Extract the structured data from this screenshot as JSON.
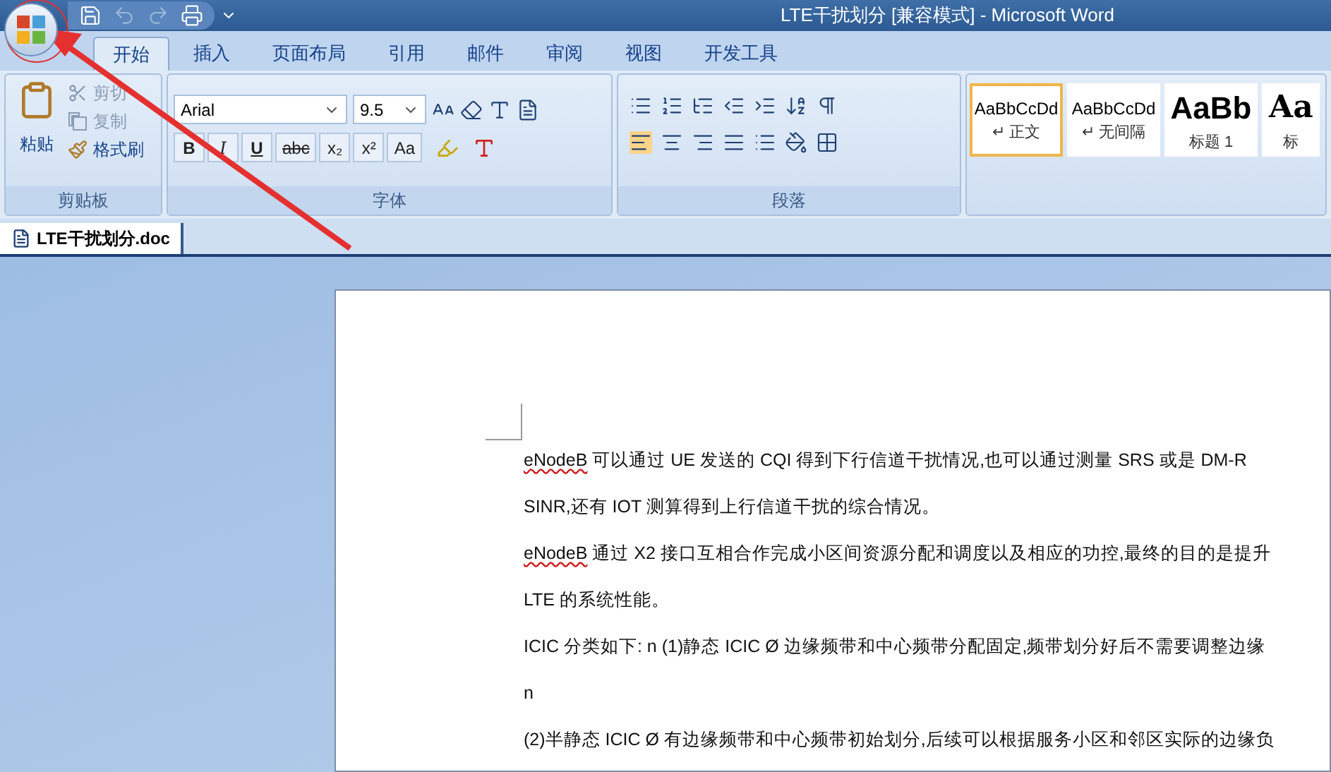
{
  "window": {
    "title": "LTE干扰划分 [兼容模式] - Microsoft Word"
  },
  "tabs": [
    {
      "label": "开始",
      "selected": true
    },
    {
      "label": "插入",
      "selected": false
    },
    {
      "label": "页面布局",
      "selected": false
    },
    {
      "label": "引用",
      "selected": false
    },
    {
      "label": "邮件",
      "selected": false
    },
    {
      "label": "审阅",
      "selected": false
    },
    {
      "label": "视图",
      "selected": false
    },
    {
      "label": "开发工具",
      "selected": false
    }
  ],
  "clipboard": {
    "paste": "粘贴",
    "cut": "剪切",
    "copy": "复制",
    "format_painter": "格式刷",
    "group": "剪贴板"
  },
  "font": {
    "name": "Arial",
    "size": "9.5",
    "group": "字体",
    "buttons": [
      {
        "label": "B",
        "kind": "bold"
      },
      {
        "label": "I",
        "kind": "italic"
      },
      {
        "label": "U",
        "kind": "underline"
      },
      {
        "label": "abc",
        "kind": "strike"
      },
      {
        "label": "x₂",
        "kind": "plain"
      },
      {
        "label": "x²",
        "kind": "plain"
      },
      {
        "label": "Aa",
        "kind": "plain"
      }
    ]
  },
  "paragraph": {
    "group": "段落"
  },
  "styles": [
    {
      "sample": "AaBbCcDd",
      "name": "↵ 正文",
      "kind": "small",
      "selected": true
    },
    {
      "sample": "AaBbCcDd",
      "name": "↵ 无间隔",
      "kind": "small",
      "selected": false
    },
    {
      "sample": "AaBb",
      "name": "标题 1",
      "kind": "large",
      "selected": false
    },
    {
      "sample": "Aa",
      "name": "标",
      "kind": "serif",
      "selected": false
    }
  ],
  "document_tab": "LTE干扰划分.doc",
  "paragraphs": [
    {
      "flagged": "eNodeB",
      "text": " 可以通过 UE 发送的 CQI 得到下行信道干扰情况,也可以通过测量 SRS 或是 DM-R"
    },
    {
      "text": "SINR,还有 IOT 测算得到上行信道干扰的综合情况。"
    },
    {
      "flagged": "eNodeB",
      "text": " 通过 X2 接口互相合作完成小区间资源分配和调度以及相应的功控,最终的目的是提升"
    },
    {
      "text": "LTE 的系统性能。"
    },
    {
      "text": "ICIC 分类如下: n (1)静态 ICIC Ø 边缘频带和中心频带分配固定,频带划分好后不需要调整边缘"
    },
    {
      "text": "n"
    },
    {
      "text": " (2)半静态 ICIC Ø 有边缘频带和中心频带初始划分,后续可以根据服务小区和邻区实际的边缘负"
    }
  ]
}
